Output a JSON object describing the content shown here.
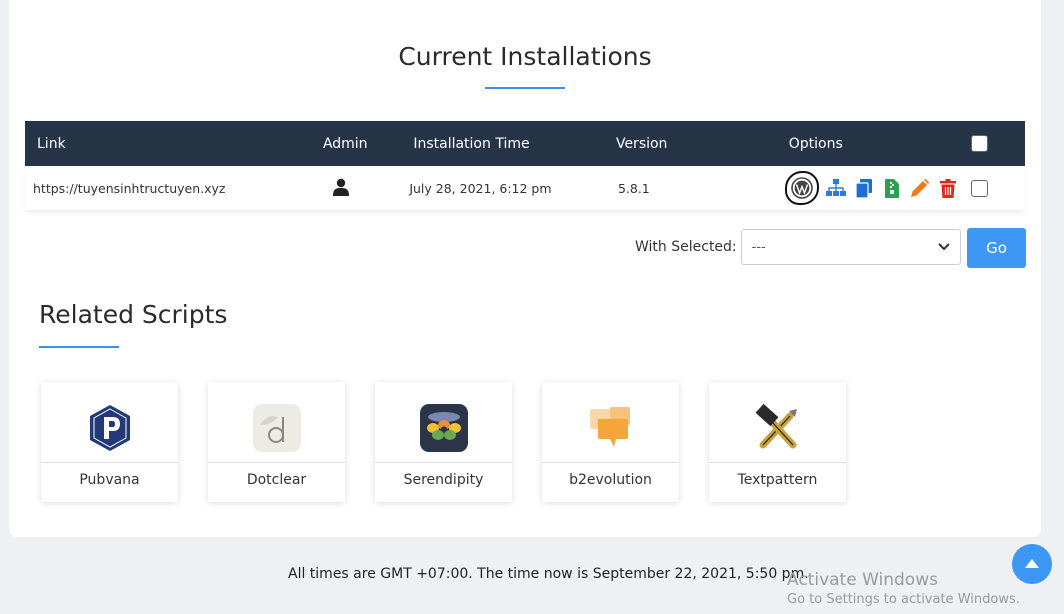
{
  "current_installations": {
    "title": "Current Installations",
    "columns": {
      "link": "Link",
      "admin": "Admin",
      "time": "Installation Time",
      "version": "Version",
      "options": "Options"
    },
    "rows": [
      {
        "link": "https://tuyensinhtructuyen.xyz",
        "admin_icon": "user-icon",
        "time": "July 28, 2021, 6:12 pm",
        "version": "5.8.1",
        "option_icons": [
          "wordpress-icon",
          "sitemap-icon",
          "copy-icon",
          "archive-icon",
          "pencil-icon",
          "trash-icon"
        ]
      }
    ],
    "with_selected": {
      "label": "With Selected:",
      "value": "---"
    },
    "go_label": "Go"
  },
  "related_scripts": {
    "title": "Related Scripts",
    "items": [
      {
        "name": "Pubvana",
        "icon": "pubvana-logo"
      },
      {
        "name": "Dotclear",
        "icon": "dotclear-logo"
      },
      {
        "name": "Serendipity",
        "icon": "serendipity-logo"
      },
      {
        "name": "b2evolution",
        "icon": "b2evolution-logo"
      },
      {
        "name": "Textpattern",
        "icon": "textpattern-logo"
      }
    ]
  },
  "footer": {
    "timezone_text": "All times are GMT +07:00. The time now is September 22, 2021, 5:50 pm."
  },
  "watermark": {
    "line1": "Activate Windows",
    "line2": "Go to Settings to activate Windows."
  },
  "colors": {
    "header_bg": "#253547",
    "accent": "#3d98f5",
    "delete": "#e0261d",
    "edit": "#f07b1c",
    "backup": "#2e9e4f"
  }
}
